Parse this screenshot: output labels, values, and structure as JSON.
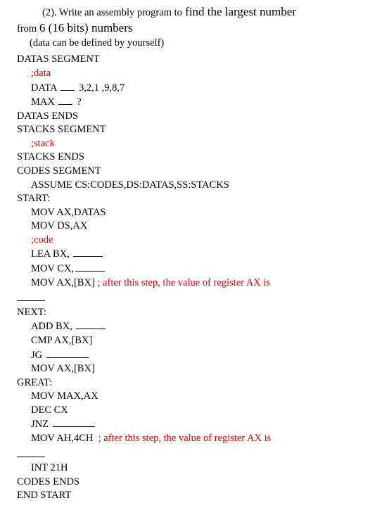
{
  "question": {
    "prefix": "(2). Write an assembly program to",
    "big1": " find the largest number",
    "line2a": " from ",
    "line2b_big": "6 (16 bits) numbers",
    "sub": "(data can be defined by yourself)"
  },
  "code": {
    "l01": "DATAS SEGMENT",
    "l02": ";data",
    "l03a": "DATA ",
    "l03b": " 3,2,1 ,9,8,7",
    "l04a": "MAX ",
    "l04b": " ?",
    "l05": "DATAS ENDS",
    "l06": "STACKS SEGMENT",
    "l07": ";stack",
    "l08": "STACKS ENDS",
    "l09": "CODES SEGMENT",
    "l10": "ASSUME CS:CODES,DS:DATAS,SS:STACKS",
    "l11": "START:",
    "l12": "MOV AX,DATAS",
    "l13": "MOV DS,AX",
    "l14": ";code",
    "l15": "LEA BX, ",
    "l16": "MOV CX,",
    "l17a": "MOV AX,[BX] ",
    "l17b": "; after this step, the value of register AX is",
    "l18": "NEXT:",
    "l19": "ADD BX, ",
    "l20": "CMP AX,[BX]",
    "l21": "JG ",
    "l22": "MOV AX,[BX]",
    "l23": "GREAT:",
    "l24": "MOV MAX,AX",
    "l25": "DEC CX",
    "l26": "JNZ ",
    "l27a": "MOV AH,4CH  ",
    "l27b": "; after this step, the value of register AX is",
    "l28": "INT 21H",
    "l29": "CODES ENDS",
    "l30": "END START"
  }
}
